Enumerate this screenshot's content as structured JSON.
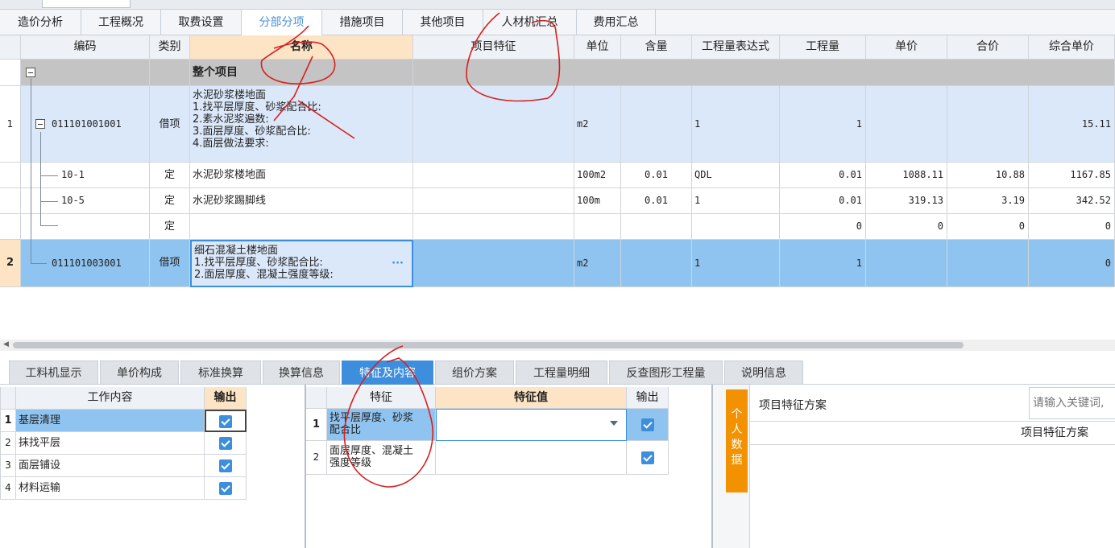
{
  "top_tabs": [
    {
      "label": "造价分析",
      "active": false
    },
    {
      "label": "工程概况",
      "active": false
    },
    {
      "label": "取费设置",
      "active": false
    },
    {
      "label": "分部分项",
      "active": true
    },
    {
      "label": "措施项目",
      "active": false
    },
    {
      "label": "其他项目",
      "active": false
    },
    {
      "label": "人材机汇总",
      "active": false
    },
    {
      "label": "费用汇总",
      "active": false
    }
  ],
  "grid": {
    "headers": [
      "编码",
      "类别",
      "名称",
      "项目特征",
      "单位",
      "含量",
      "工程量表达式",
      "工程量",
      "单价",
      "合价",
      "综合单价"
    ],
    "group_row": {
      "name": "整个项目"
    },
    "rows": [
      {
        "no": "1",
        "code": "011101001001",
        "type": "借项",
        "name_lines": [
          "水泥砂浆楼地面",
          "1.找平层厚度、砂浆配合比:",
          "2.素水泥浆遍数:",
          "3.面层厚度、砂浆配合比:",
          "4.面层做法要求:"
        ],
        "unit": "m2",
        "content": "",
        "expr": "1",
        "qty": "1",
        "price": "",
        "total": "",
        "composite": "15.11"
      },
      {
        "no": "",
        "code": "10-1",
        "type": "定",
        "name": "水泥砂浆楼地面",
        "unit": "100m2",
        "content": "0.01",
        "expr": "QDL",
        "qty": "0.01",
        "price": "1088.11",
        "total": "10.88",
        "composite": "1167.85"
      },
      {
        "no": "",
        "code": "10-5",
        "type": "定",
        "name": "水泥砂浆踢脚线",
        "unit": "100m",
        "content": "0.01",
        "expr": "1",
        "qty": "0.01",
        "price": "319.13",
        "total": "3.19",
        "composite": "342.52"
      },
      {
        "no": "",
        "code": "",
        "type": "定",
        "name": "",
        "unit": "",
        "content": "",
        "expr": "",
        "qty": "0",
        "price": "0",
        "total": "0",
        "composite": "0"
      },
      {
        "no": "2",
        "code": "011101003001",
        "type": "借项",
        "name_lines": [
          "细石混凝土楼地面",
          "1.找平层厚度、砂浆配合比:",
          "2.面层厚度、混凝土强度等级:"
        ],
        "ellipsis": "···",
        "unit": "m2",
        "content": "",
        "expr": "1",
        "qty": "1",
        "price": "",
        "total": "",
        "composite": "0"
      }
    ]
  },
  "bottom_tabs": [
    {
      "label": "工料机显示",
      "active": false
    },
    {
      "label": "单价构成",
      "active": false
    },
    {
      "label": "标准换算",
      "active": false
    },
    {
      "label": "换算信息",
      "active": false
    },
    {
      "label": "特征及内容",
      "active": true
    },
    {
      "label": "组价方案",
      "active": false
    },
    {
      "label": "工程量明细",
      "active": false
    },
    {
      "label": "反查图形工程量",
      "active": false
    },
    {
      "label": "说明信息",
      "active": false
    }
  ],
  "work_content": {
    "headers": [
      "工作内容",
      "输出"
    ],
    "rows": [
      {
        "no": "1",
        "label": "基层清理",
        "checked": true
      },
      {
        "no": "2",
        "label": "抹找平层",
        "checked": true
      },
      {
        "no": "3",
        "label": "面层铺设",
        "checked": true
      },
      {
        "no": "4",
        "label": "材料运输",
        "checked": true
      }
    ]
  },
  "features": {
    "headers": [
      "特征",
      "特征值",
      "输出"
    ],
    "rows": [
      {
        "no": "1",
        "lines": [
          "找平层厚度、砂浆",
          "配合比"
        ],
        "value": "",
        "checked": true
      },
      {
        "no": "2",
        "lines": [
          "面层厚度、混凝土",
          "强度等级"
        ],
        "value": "",
        "checked": true
      }
    ]
  },
  "scheme": {
    "side_tab": "个人数据",
    "title": "项目特征方案",
    "search_placeholder": "请输入关键词,",
    "col_header": "项目特征方案"
  },
  "colors": {
    "accent": "#3d8fdd",
    "selected_row": "#90c4f0",
    "light_row": "#dbe8fa",
    "group_row": "#c4c4c4",
    "orange": "#f39200",
    "active_name_header": "#fde4c4"
  }
}
